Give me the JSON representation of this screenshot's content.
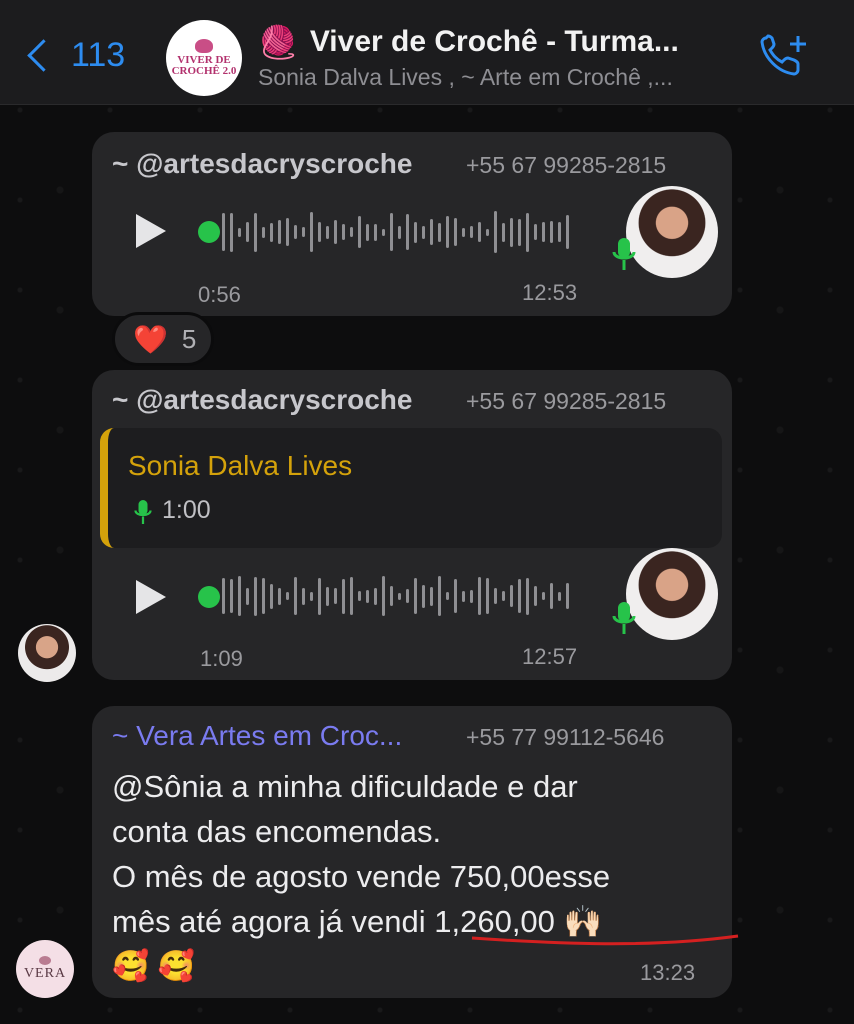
{
  "header": {
    "back_count": "113",
    "group_title": "Viver de Crochê - Turma...",
    "title_emoji": "🧶",
    "group_subtitle": "Sonia Dalva Lives , ~ Arte em Crochê ,...",
    "avatar_logo_line1": "VIVER DE",
    "avatar_logo_line2": "CROCHÊ 2.0",
    "call_icon": "phone-plus-icon"
  },
  "messages": [
    {
      "type": "voice",
      "sender": "~ @artesdacryscroche",
      "sender_color": "#c7c7cc",
      "phone": "+55 67 99285-2815",
      "duration": "0:56",
      "time": "12:53",
      "reaction": {
        "emoji": "❤️",
        "count": "5"
      }
    },
    {
      "type": "voice-reply",
      "sender": "~ @artesdacryscroche",
      "sender_color": "#c7c7cc",
      "phone": "+55 67 99285-2815",
      "quoted_name": "Sonia Dalva Lives",
      "quoted_duration": "1:00",
      "duration": "1:09",
      "time": "12:57"
    },
    {
      "type": "text",
      "sender": "~ Vera Artes em Croc...",
      "sender_color": "#7a7bf0",
      "phone": "+55 77 99112-5646",
      "lines": [
        "@Sônia  a minha  dificuldade  e dar",
        "conta  das encomendas.",
        "O mês  de agosto  vende 750,00esse",
        "mês até agora  já vendi  1,260,00 🙌🏻",
        "🥰 🥰"
      ],
      "time": "13:23",
      "avatar_text": "VERA"
    }
  ],
  "colors": {
    "accent_blue": "#2d8cf0",
    "voice_green": "#27c34a",
    "quote_gold": "#d4a20b",
    "underline_red": "#d42020"
  }
}
